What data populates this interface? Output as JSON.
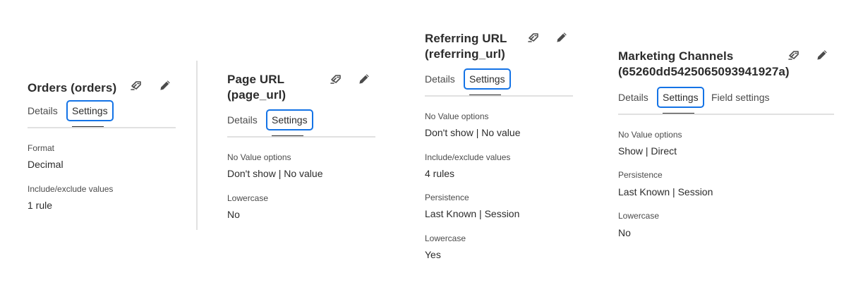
{
  "panels": [
    {
      "title_lines": [
        "Orders (orders)"
      ],
      "tabs": [
        "Details",
        "Settings"
      ],
      "selected_tab": "Settings",
      "fields": [
        {
          "label": "Format",
          "value": "Decimal"
        },
        {
          "label": "Include/exclude values",
          "value": "1 rule"
        }
      ]
    },
    {
      "title_lines": [
        "Page URL",
        "(page_url)"
      ],
      "tabs": [
        "Details",
        "Settings"
      ],
      "selected_tab": "Settings",
      "fields": [
        {
          "label": "No Value options",
          "value": "Don't show | No value"
        },
        {
          "label": "Lowercase",
          "value": "No"
        }
      ]
    },
    {
      "title_lines": [
        "Referring URL",
        "(referring_url)"
      ],
      "tabs": [
        "Details",
        "Settings"
      ],
      "selected_tab": "Settings",
      "fields": [
        {
          "label": "No Value options",
          "value": "Don't show | No value"
        },
        {
          "label": "Include/exclude values",
          "value": "4 rules"
        },
        {
          "label": "Persistence",
          "value": "Last Known | Session"
        },
        {
          "label": "Lowercase",
          "value": "Yes"
        }
      ]
    },
    {
      "title_lines": [
        "Marketing Channels",
        "(65260dd5425065093941927a)"
      ],
      "tabs": [
        "Details",
        "Settings",
        "Field settings"
      ],
      "selected_tab": "Settings",
      "fields": [
        {
          "label": "No Value options",
          "value": "Show | Direct"
        },
        {
          "label": "Persistence",
          "value": "Last Known | Session"
        },
        {
          "label": "Lowercase",
          "value": "No"
        }
      ]
    }
  ],
  "icons": {
    "remove": "remove-component-icon",
    "edit": "edit-pencil-icon"
  },
  "colors": {
    "selected_tab_border": "#1473e6",
    "text": "#2c2c2c",
    "muted_text": "#4b4b4b",
    "rule": "#e1e1e1"
  }
}
